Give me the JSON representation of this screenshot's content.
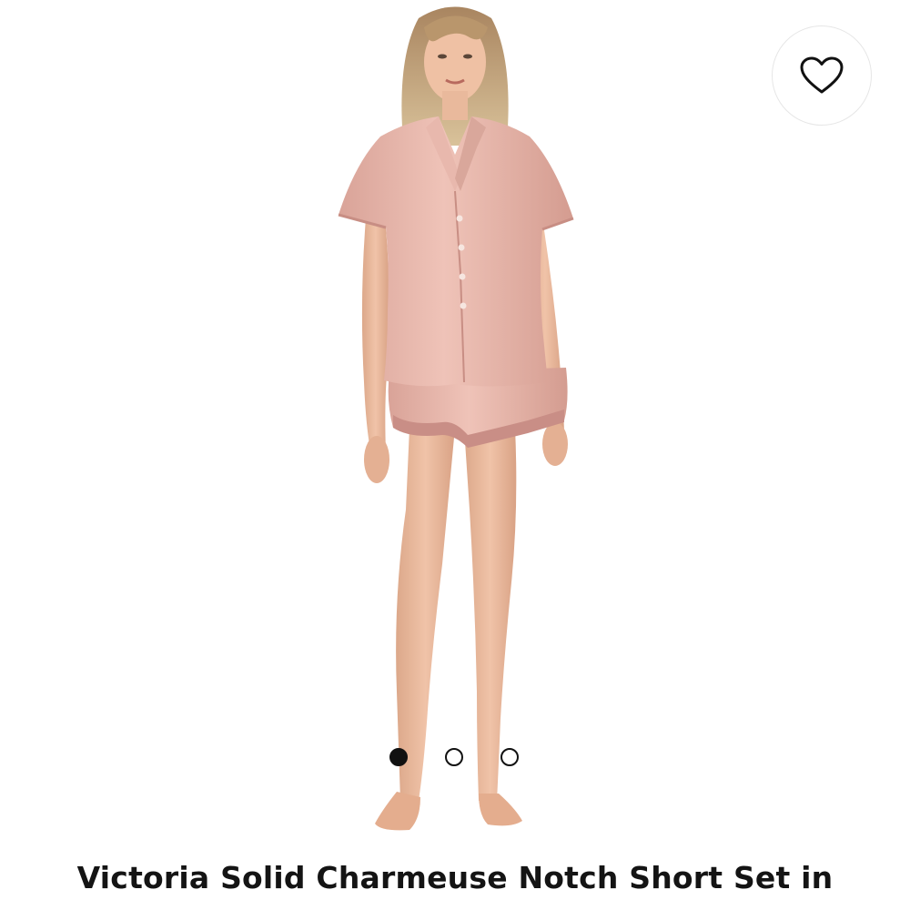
{
  "product": {
    "title": "Victoria Solid Charmeuse Notch Short Set in",
    "image_icon": "model-wearing-pajama-set-image"
  },
  "favorite": {
    "icon": "heart-outline-icon"
  },
  "carousel": {
    "total": 3,
    "active_index": 0
  },
  "colors": {
    "satin_pink": "#e3b2a8",
    "skin": "#e8b99c",
    "text": "#141414",
    "dot": "#111111"
  }
}
